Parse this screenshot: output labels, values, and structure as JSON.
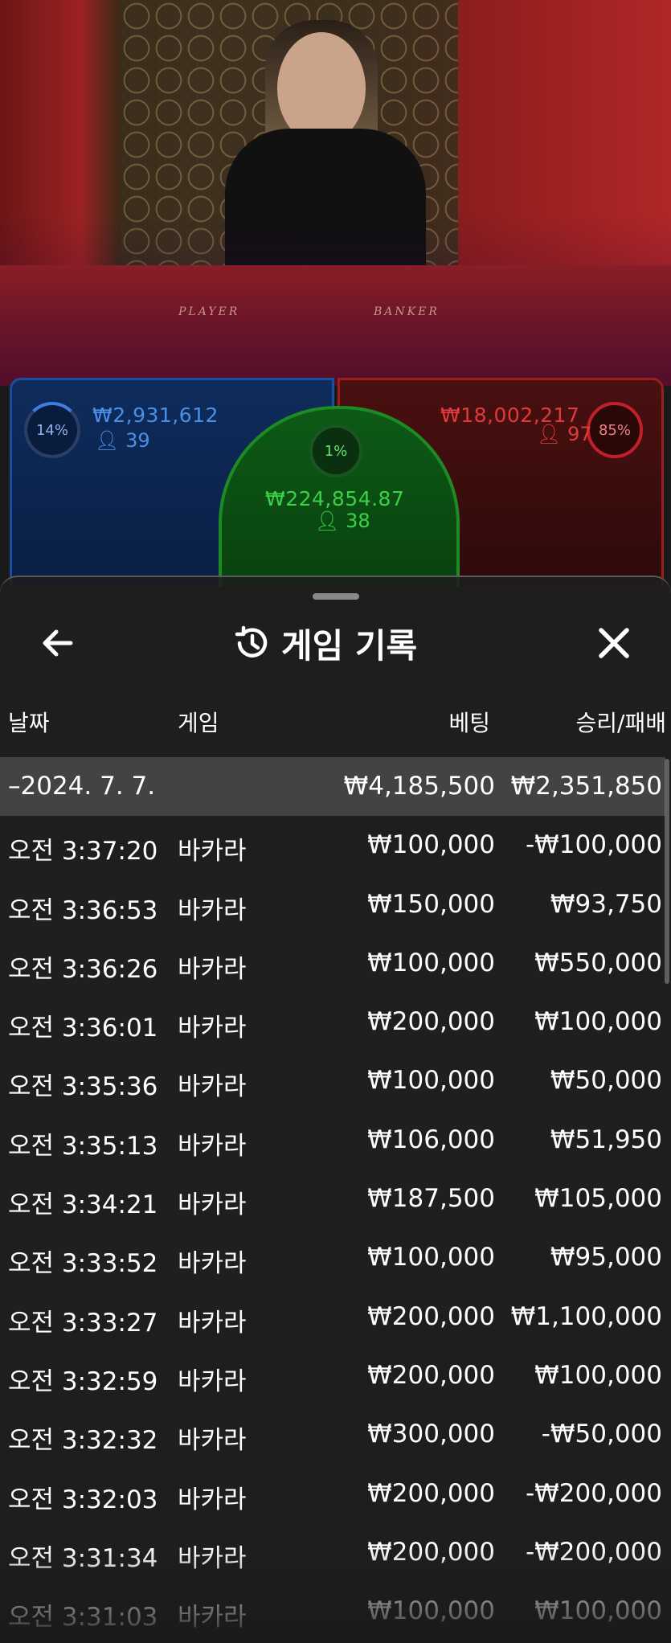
{
  "video": {
    "table_left_label": "PLAYER",
    "table_right_label": "BANKER"
  },
  "betting": {
    "player": {
      "percent": "14%",
      "amount": "₩2,931,612",
      "players": "39"
    },
    "tie": {
      "percent": "1%",
      "amount": "₩224,854.87",
      "players": "38"
    },
    "banker": {
      "percent": "85%",
      "amount": "₩18,002,217",
      "players": "97"
    }
  },
  "history": {
    "title": "게임 기록",
    "columns": {
      "date": "날짜",
      "game": "게임",
      "bet": "베팅",
      "result": "승리/패배"
    },
    "total": {
      "date": "–2024. 7. 7.",
      "bet": "₩4,185,500",
      "result": "₩2,351,850"
    },
    "rows": [
      {
        "time": "오전 3:37:20",
        "game": "바카라",
        "bet": "₩100,000",
        "result": "-₩100,000"
      },
      {
        "time": "오전 3:36:53",
        "game": "바카라",
        "bet": "₩150,000",
        "result": "₩93,750"
      },
      {
        "time": "오전 3:36:26",
        "game": "바카라",
        "bet": "₩100,000",
        "result": "₩550,000"
      },
      {
        "time": "오전 3:36:01",
        "game": "바카라",
        "bet": "₩200,000",
        "result": "₩100,000"
      },
      {
        "time": "오전 3:35:36",
        "game": "바카라",
        "bet": "₩100,000",
        "result": "₩50,000"
      },
      {
        "time": "오전 3:35:13",
        "game": "바카라",
        "bet": "₩106,000",
        "result": "₩51,950"
      },
      {
        "time": "오전 3:34:21",
        "game": "바카라",
        "bet": "₩187,500",
        "result": "₩105,000"
      },
      {
        "time": "오전 3:33:52",
        "game": "바카라",
        "bet": "₩100,000",
        "result": "₩95,000"
      },
      {
        "time": "오전 3:33:27",
        "game": "바카라",
        "bet": "₩200,000",
        "result": "₩1,100,000"
      },
      {
        "time": "오전 3:32:59",
        "game": "바카라",
        "bet": "₩200,000",
        "result": "₩100,000"
      },
      {
        "time": "오전 3:32:32",
        "game": "바카라",
        "bet": "₩300,000",
        "result": "-₩50,000"
      },
      {
        "time": "오전 3:32:03",
        "game": "바카라",
        "bet": "₩200,000",
        "result": "-₩200,000"
      },
      {
        "time": "오전 3:31:34",
        "game": "바카라",
        "bet": "₩200,000",
        "result": "-₩200,000"
      },
      {
        "time": "오전 3:31:03",
        "game": "바카라",
        "bet": "₩100,000",
        "result": "₩100,000"
      }
    ]
  },
  "colors": {
    "player": "#4a8fe8",
    "banker": "#e03a3a",
    "tie": "#3cd048"
  },
  "icons": {
    "back": "arrow-left-icon",
    "history": "history-clock-icon",
    "close": "close-icon",
    "person": "person-icon"
  }
}
